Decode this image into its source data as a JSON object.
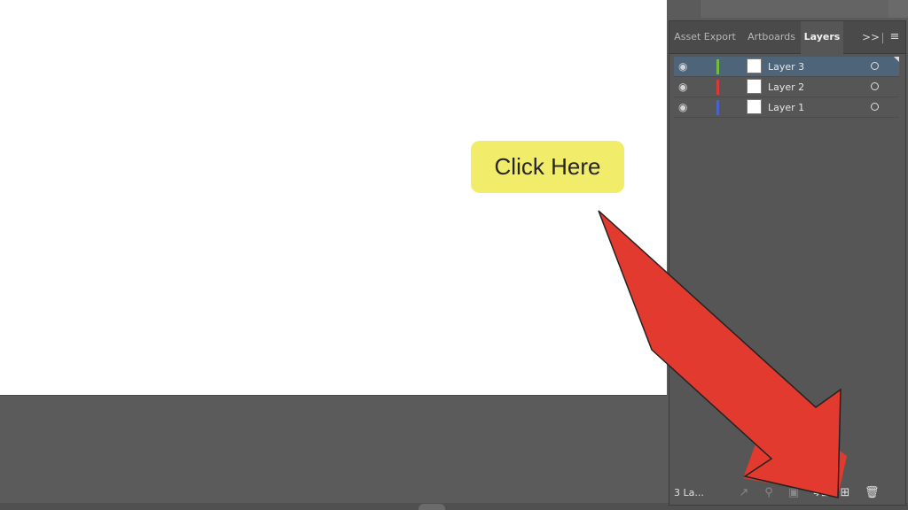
{
  "tabs": {
    "asset_export": "Asset Export",
    "artboards": "Artboards",
    "layers": "Layers",
    "overflow": ">>",
    "menu": "≡"
  },
  "layers": [
    {
      "name": "Layer 3",
      "color": "#6fbf3a",
      "selected": true
    },
    {
      "name": "Layer 2",
      "color": "#d63b3b",
      "selected": false
    },
    {
      "name": "Layer 1",
      "color": "#4a63c8",
      "selected": false
    }
  ],
  "footer": {
    "status": "3 La...",
    "icons": [
      "export-icon",
      "search-icon",
      "clip-icon",
      "move-to-layer-icon",
      "new-layer-icon",
      "trash-icon"
    ]
  },
  "callout": {
    "text": "Click Here",
    "color": "#f1ec6a"
  },
  "arrow": {
    "color": "#e23a2e"
  },
  "colors": {
    "panel_bg": "#565656",
    "canvas_bg": "#ffffff",
    "selected_row": "#4d6479"
  }
}
